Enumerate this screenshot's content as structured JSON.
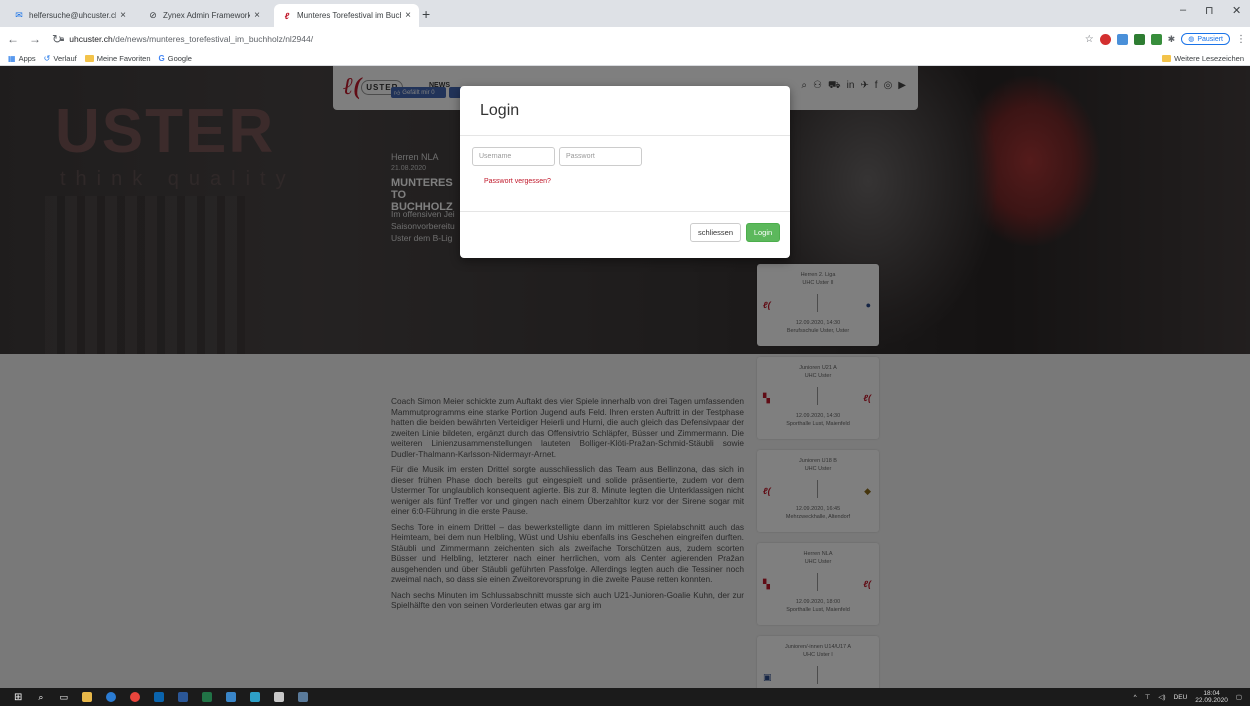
{
  "browser": {
    "tabs": [
      {
        "title": "helfersuche@uhcuster.ch",
        "icon": "mail-icon"
      },
      {
        "title": "Zynex Admin Framework",
        "icon": "globe-icon"
      },
      {
        "title": "Munteres Torefestival im Buchho",
        "icon": "uhc-icon",
        "active": true
      }
    ],
    "window": {
      "minimize": "–",
      "maximize": "⊓",
      "close": "✕"
    },
    "url_host": "uhcuster.ch",
    "url_path": "/de/news/munteres_torefestival_im_buchholz/nl2944/",
    "paused_label": "Pausiert",
    "bookmarks": [
      {
        "label": "Apps"
      },
      {
        "label": "Verlauf"
      },
      {
        "label": "Meine Favoriten"
      },
      {
        "label": "Google"
      }
    ],
    "other_bookmarks": "Weitere Lesezeichen"
  },
  "site": {
    "logo_text": "USTER",
    "nav_news": "NEWS",
    "hero_brand": "USTER",
    "hero_sub": "think quality",
    "fb_like": "Gefällt mir 0"
  },
  "article": {
    "category": "Herren NLA",
    "date": "21.08.2020",
    "title_1": "MUNTERES TO",
    "title_2": "BUCHHOLZ",
    "lead_1": "Im offensiven Jei",
    "lead_2": "Saisonvorbereitu",
    "lead_3": "Uster dem B-Lig",
    "paragraphs": [
      "Coach Simon Meier schickte zum Auftakt des vier Spiele innerhalb von drei Tagen umfassenden Mammutprogramms eine starke Portion Jugend aufs Feld. Ihren ersten Auftritt in der Testphase hatten die beiden bewährten Verteidiger Heierli und Hurni, die auch gleich das Defensivpaar der zweiten Linie bildeten, ergänzt durch das Offensivtrio Schläpfer, Büsser und Zimmermann. Die weiteren Linienzusammenstellungen lauteten Bolliger-Klöti-Pražan-Schmid-Stäubli sowie Dudler-Thalmann-Karlsson-Nidermayr-Arnet.",
      "Für die Musik im ersten Drittel sorgte ausschliesslich das Team aus Bellinzona, das sich in dieser frühen Phase doch bereits gut eingespielt und solide präsentierte, zudem vor dem Ustermer Tor unglaublich konsequent agierte. Bis zur 8. Minute legten die Unterklassigen nicht weniger als fünf Treffer vor und gingen nach einem Überzahltor kurz vor der Sirene sogar mit einer 6:0-Führung in die erste Pause.",
      "Sechs Tore in einem Drittel – das bewerkstelligte dann im mittleren Spielabschnitt auch das Heimteam, bei dem nun Helbling, Wüst und Ushiu ebenfalls ins Geschehen eingreifen durften. Stäubli und Zimmermann zeichenten sich als zweifache Torschützen aus, zudem scorten Büsser und Helbling, letzterer nach einer herrlichen, vom als Center agierenden Pražan ausgehenden und über Stäubli geführten Passfolge. Allerdings legten auch die Tessiner noch zweimal nach, so dass sie einen Zweitorevorsprung in die zweite Pause retten konnten.",
      "Nach sechs Minuten im Schlussabschnitt musste sich auch U21-Junioren-Goalie Kuhn, der zur Spielhälfte den von seinen Vorderleuten etwas gar arg im"
    ]
  },
  "games": [
    {
      "league": "Herren 2. Liga",
      "team": "UHC Uster II",
      "when": "12.09.2020, 14:30",
      "where": "Berufsschule Uster, Uster"
    },
    {
      "league": "Junioren U21 A",
      "team": "UHC Uster",
      "when": "12.09.2020, 14:30",
      "where": "Sporthalle Lust, Maienfeld"
    },
    {
      "league": "Junioren U18 B",
      "team": "UHC Uster",
      "when": "12.09.2020, 16:45",
      "where": "Mehrzweckhalle, Altendorf"
    },
    {
      "league": "Herren NLA",
      "team": "UHC Uster",
      "when": "12.09.2020, 18:00",
      "where": "Sporthalle Lust, Maienfeld"
    },
    {
      "league": "Junioren/-innen U14/U17 A",
      "team": "UHC Uster I",
      "when": "",
      "where": ""
    }
  ],
  "modal": {
    "title": "Login",
    "username_placeholder": "Username",
    "password_placeholder": "Passwort",
    "forgot": "Passwort vergessen?",
    "close_label": "schliessen",
    "login_label": "Login"
  },
  "taskbar": {
    "lang": "DEU",
    "time": "18:04",
    "date": "22.09.2020"
  },
  "colors": {
    "brand_red": "#c0182a",
    "login_green": "#5cb85c",
    "fb_blue": "#4267b2"
  }
}
